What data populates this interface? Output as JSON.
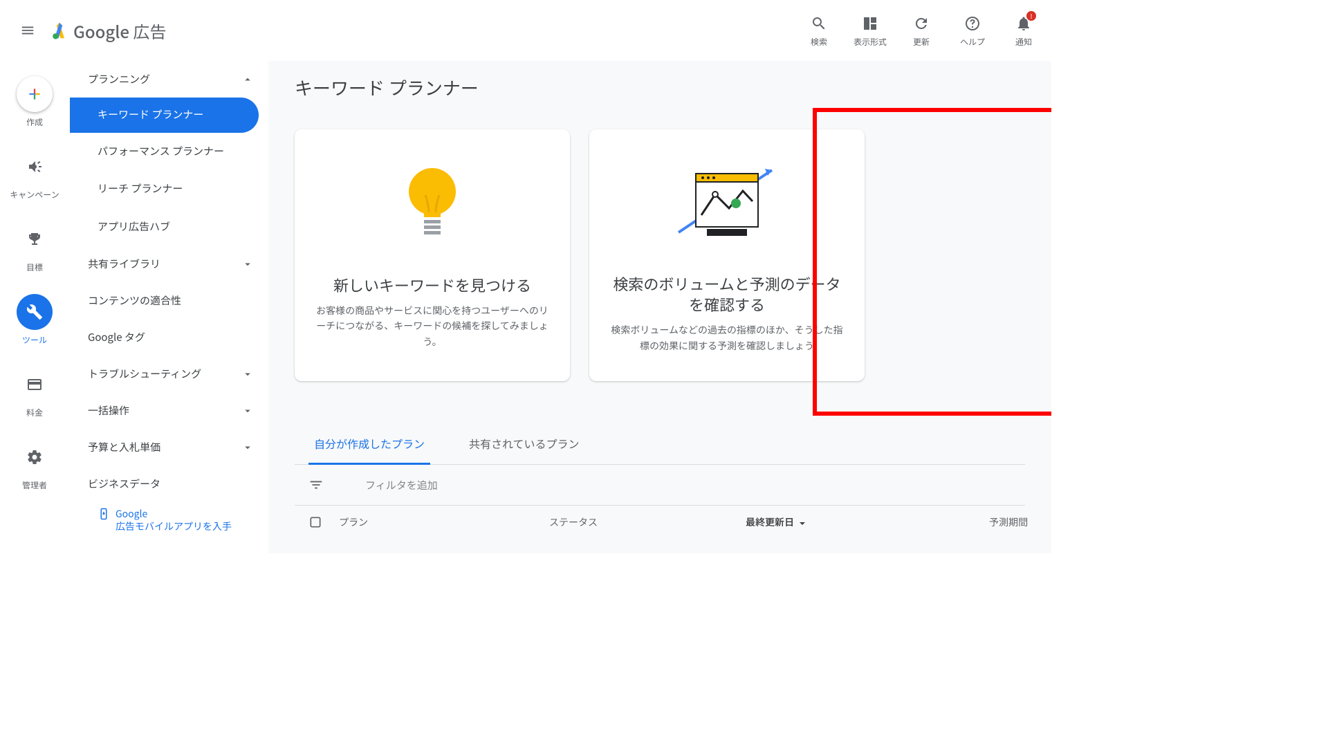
{
  "header": {
    "product": "Google",
    "product_suffix": "広告",
    "actions": {
      "search": "検索",
      "display": "表示形式",
      "refresh": "更新",
      "help": "ヘルプ",
      "notifications": "通知"
    }
  },
  "rail": {
    "create": "作成",
    "campaigns": "キャンペーン",
    "goals": "目標",
    "tools": "ツール",
    "billing": "料金",
    "admin": "管理者"
  },
  "sidebar": {
    "planning": {
      "label": "プランニング"
    },
    "keyword_planner": "キーワード プランナー",
    "performance_planner": "パフォーマンス プランナー",
    "reach_planner": "リーチ プランナー",
    "app_hub": "アプリ広告ハブ",
    "shared_library": "共有ライブラリ",
    "content_suitability": "コンテンツの適合性",
    "google_tag": "Google タグ",
    "troubleshooting": "トラブルシューティング",
    "bulk_actions": "一括操作",
    "budgets": "予算と入札単価",
    "business_data": "ビジネスデータ",
    "mobile_app_link": "Google\n広告モバイルアプリを入手"
  },
  "main": {
    "title": "キーワード プランナー",
    "card1": {
      "title": "新しいキーワードを見つける",
      "desc": "お客様の商品やサービスに関心を持つユーザーへのリーチにつながる、キーワードの候補を探してみましょう。"
    },
    "card2": {
      "title": "検索のボリュームと予測のデータを確認する",
      "desc": "検索ボリュームなどの過去の指標のほか、そうした指標の効果に関する予測を確認しましょう"
    },
    "tabs": {
      "my_plans": "自分が作成したプラン",
      "shared_plans": "共有されているプラン"
    },
    "filter_placeholder": "フィルタを追加",
    "table": {
      "plan": "プラン",
      "status": "ステータス",
      "last_updated": "最終更新日",
      "forecast_period": "予測期間"
    }
  }
}
